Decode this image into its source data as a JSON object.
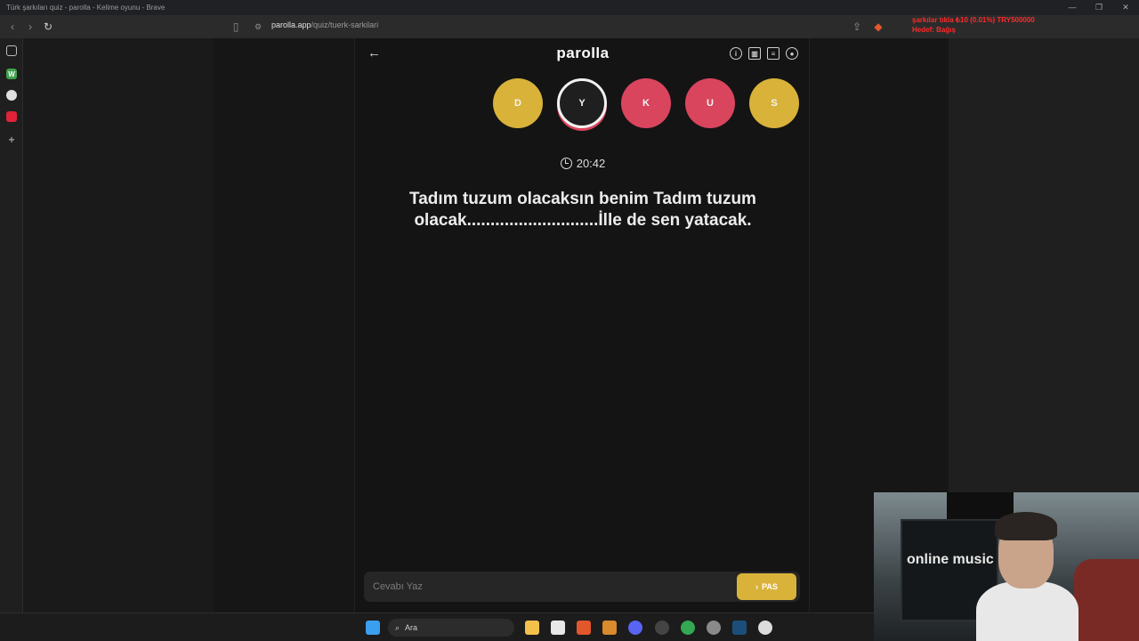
{
  "window": {
    "title": "Türk şarkıları quiz - parolla - Kelime oyunu - Brave",
    "controls": [
      "—",
      "❐",
      "✕"
    ]
  },
  "browser": {
    "url_domain": "parolla.app",
    "url_path": "/quiz/tuerk-sarkilari"
  },
  "stream_overlay": {
    "line1": "şarkılar tıkla     ₺10 (0.01%)     TRY500000",
    "line2": "Hedef: Bağış"
  },
  "app": {
    "logo": "parolla",
    "letters": [
      {
        "char": "D",
        "state": "yellow"
      },
      {
        "char": "Y",
        "state": "active"
      },
      {
        "char": "K",
        "state": "red"
      },
      {
        "char": "U",
        "state": "red"
      },
      {
        "char": "S",
        "state": "yellow"
      }
    ],
    "timer": "20:42",
    "question": "Tadım tuzum olacaksın benim Tadım tuzum olacak............................İlle de sen yatacak.",
    "answer_placeholder": "Cevabı Yaz",
    "pass_label": "PAS"
  },
  "taskbar": {
    "search_label": "Ara"
  },
  "webcam": {
    "poster_text": "online music"
  },
  "colors": {
    "yellow": "#d9b23a",
    "red": "#d9455d"
  }
}
